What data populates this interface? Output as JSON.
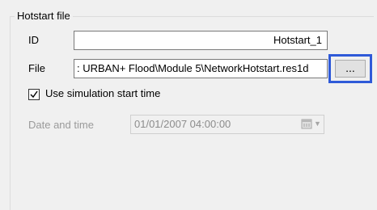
{
  "group": {
    "title": "Hotstart file"
  },
  "id_field": {
    "label": "ID",
    "value": "Hotstart_1"
  },
  "file_field": {
    "label": "File",
    "value": ": URBAN+ Flood\\Module 5\\NetworkHotstart.res1d",
    "browse_label": "..."
  },
  "use_sim_start": {
    "label": "Use simulation start time",
    "checked": true
  },
  "date_field": {
    "label": "Date and time",
    "value": "01/01/2007 04:00:00",
    "enabled": false
  },
  "colors": {
    "highlight": "#2f5ad8",
    "disabled_text": "#9a9a9a",
    "background": "#f0f0f0"
  }
}
